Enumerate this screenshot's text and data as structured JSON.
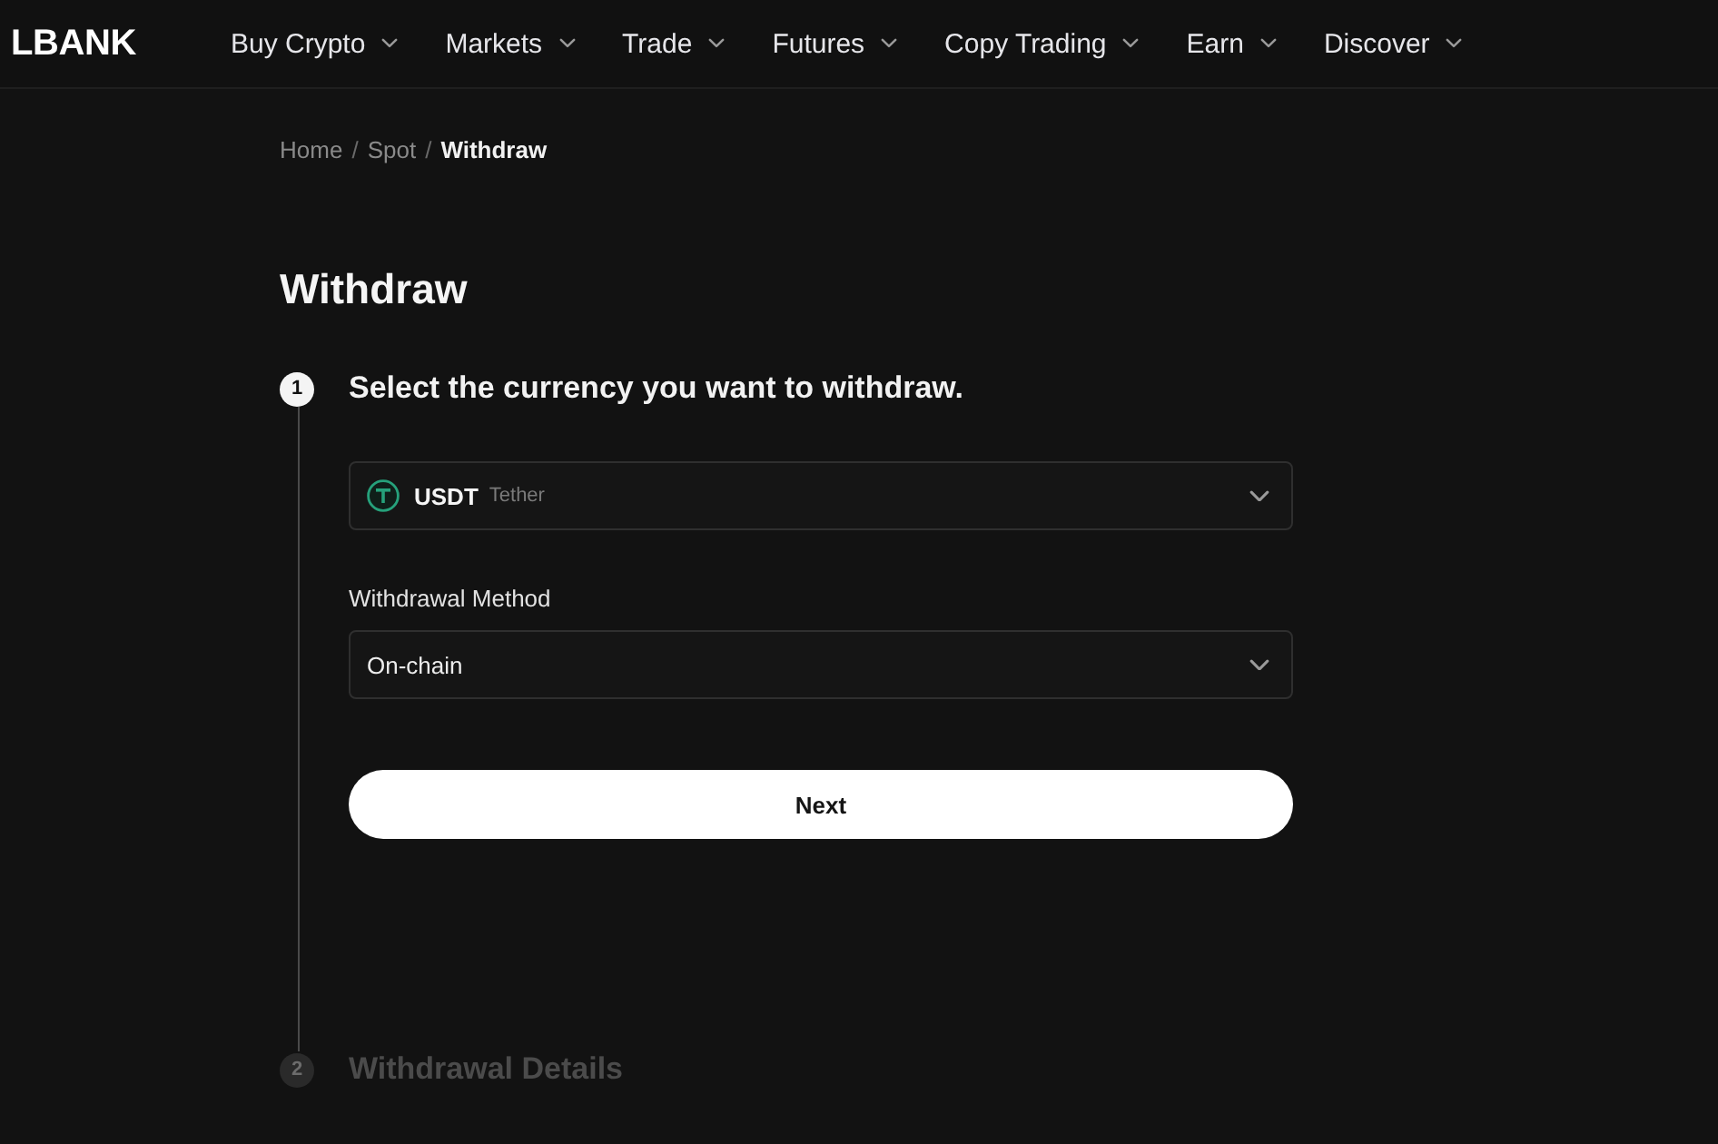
{
  "header": {
    "logo": "LBANK",
    "nav": [
      {
        "label": "Buy Crypto",
        "dropdown": true
      },
      {
        "label": "Markets",
        "dropdown": true
      },
      {
        "label": "Trade",
        "dropdown": true
      },
      {
        "label": "Futures",
        "dropdown": true
      },
      {
        "label": "Copy Trading",
        "dropdown": true
      },
      {
        "label": "Earn",
        "dropdown": true
      },
      {
        "label": "Discover",
        "dropdown": true
      }
    ]
  },
  "breadcrumb": [
    {
      "kind": "link",
      "label": "Home",
      "current": false
    },
    {
      "kind": "separator",
      "label": "/"
    },
    {
      "kind": "link",
      "label": "Spot",
      "current": false
    },
    {
      "kind": "separator",
      "label": "/"
    },
    {
      "kind": "link",
      "label": "Withdraw",
      "current": true
    }
  ],
  "title": "Withdraw",
  "steps": [
    {
      "number": "1",
      "title": "Select the currency you want to withdraw.",
      "active": true,
      "currency_select": {
        "symbol": "USDT",
        "name": "Tether"
      },
      "method_field": {
        "label": "Withdrawal Method",
        "value": "On-chain"
      },
      "next_button": {
        "label": "Next"
      }
    },
    {
      "number": "2",
      "title": "Withdrawal Details",
      "active": false
    }
  ]
}
